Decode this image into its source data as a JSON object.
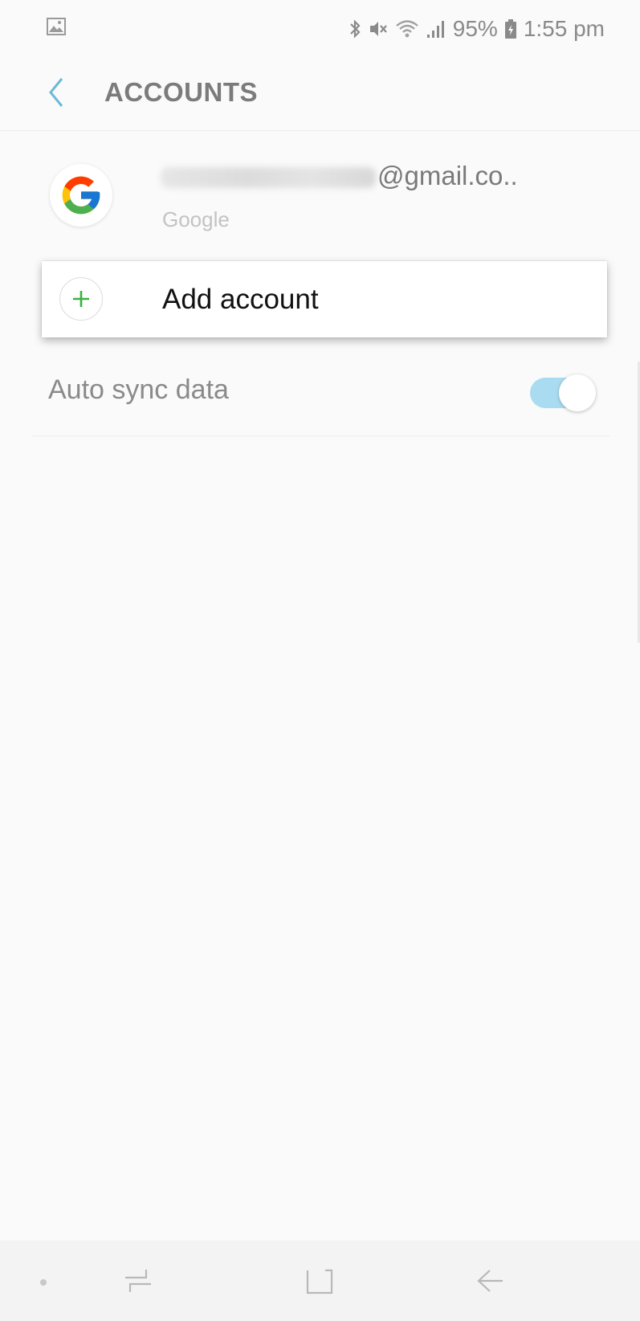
{
  "status_bar": {
    "left_icon": "image-notification-icon",
    "icons": [
      "bluetooth-icon",
      "mute-icon",
      "wifi-icon",
      "signal-icon"
    ],
    "battery_percent": "95%",
    "battery_icon": "battery-icon",
    "time": "1:55 pm"
  },
  "header": {
    "back_icon": "back-chevron-icon",
    "title": "ACCOUNTS"
  },
  "account": {
    "icon": "google-icon",
    "email_visible": "@gmail.co..",
    "type": "Google"
  },
  "add_account": {
    "icon": "plus-icon",
    "label": "Add account"
  },
  "auto_sync": {
    "label": "Auto sync data",
    "enabled": true
  },
  "nav_bar": {
    "buttons": [
      "recent-apps-icon",
      "home-icon",
      "back-arrow-icon"
    ]
  },
  "colors": {
    "accent": "#6cb9d6",
    "toggle_track": "#a9dcf0",
    "plus_green": "#3cb043"
  }
}
